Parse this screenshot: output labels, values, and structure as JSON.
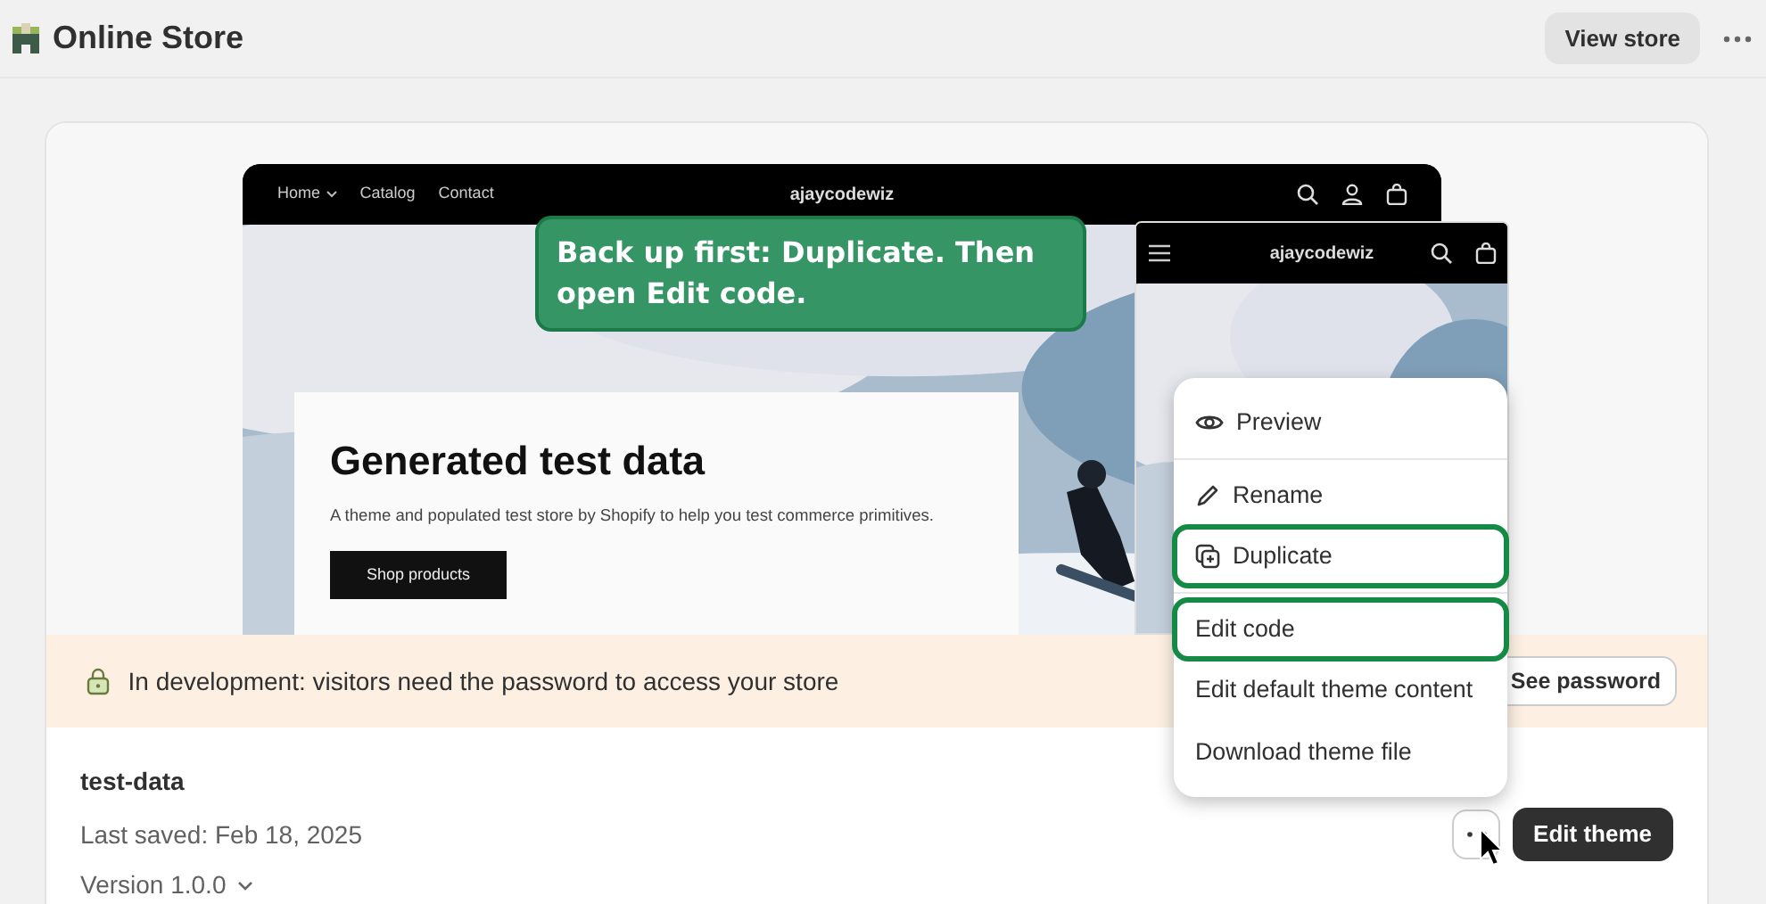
{
  "header": {
    "title": "Online Store",
    "view_button": "View store"
  },
  "preview": {
    "desktop": {
      "nav": [
        {
          "label": "Home",
          "dropdown": true
        },
        {
          "label": "Catalog",
          "dropdown": false
        },
        {
          "label": "Contact",
          "dropdown": false
        }
      ],
      "brand": "ajaycodewiz",
      "hero": {
        "heading": "Generated test data",
        "text": "A theme and populated test store by Shopify to help you test commerce primitives.",
        "button": "Shop products"
      }
    },
    "mobile": {
      "brand": "ajaycodewiz"
    }
  },
  "callout": {
    "text": "Back up first: Duplicate. Then open Edit code."
  },
  "banner": {
    "text": "In development: visitors need the password to access your store",
    "button": "See password"
  },
  "theme": {
    "name": "test-data",
    "last_saved": "Last saved: Feb 18, 2025",
    "version": "Version 1.0.0",
    "edit_button": "Edit theme"
  },
  "menu": {
    "sections": [
      {
        "items": [
          {
            "label": "Preview",
            "kind": "eye",
            "highlighted": false
          }
        ]
      },
      {
        "items": [
          {
            "label": "Rename",
            "kind": "pencil",
            "highlighted": false
          },
          {
            "label": "Duplicate",
            "kind": "duplicate",
            "highlighted": true
          }
        ]
      },
      {
        "items": [
          {
            "label": "Edit code",
            "highlighted": true
          },
          {
            "label": "Edit default theme content",
            "highlighted": false
          },
          {
            "label": "Download theme file",
            "highlighted": false
          }
        ]
      }
    ]
  }
}
